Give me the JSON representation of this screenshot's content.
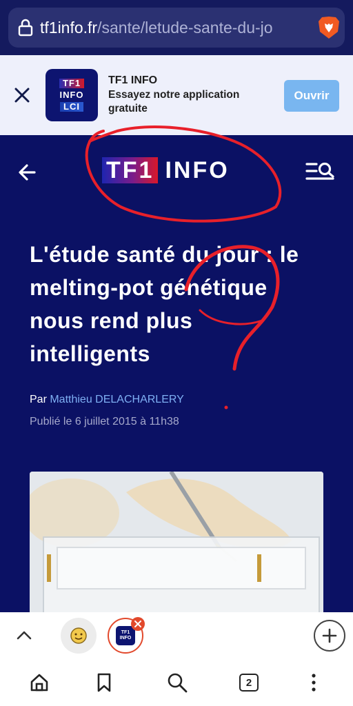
{
  "browser": {
    "url_domain": "tf1info.fr",
    "url_path": "/sante/letude-sante-du-jo",
    "tab_count": "2"
  },
  "app_banner": {
    "app_name": "TF1 INFO",
    "subtitle": "Essayez notre application gratuite",
    "open_label": "Ouvrir",
    "icon_lines": [
      "TF1",
      "INFO",
      "LCI"
    ]
  },
  "site_header": {
    "logo_tf1": "TF1",
    "logo_info": "INFO"
  },
  "article": {
    "title": "L'étude santé du jour : le melting-pot génétique nous rend plus intelligents",
    "by_prefix": "Par ",
    "author": "Matthieu DELACHARLERY",
    "published": "Publié le 6 juillet 2015 à 11h38"
  },
  "bottom_tabs": {
    "tab2_icon_lines": [
      "TF1",
      "INFO"
    ]
  },
  "colors": {
    "background": "#0b1164",
    "author_link": "#7fb0f4",
    "open_button": "#79b6f0",
    "scribble": "#e8202a",
    "tab_close": "#e2492c"
  }
}
